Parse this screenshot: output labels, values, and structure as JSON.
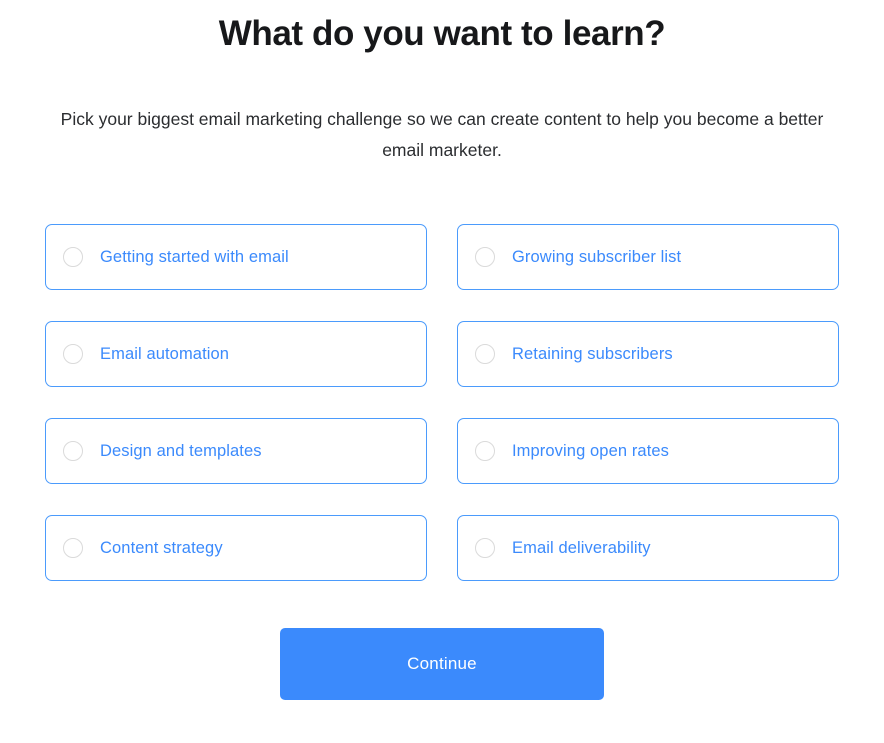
{
  "header": {
    "title": "What do you want to learn?",
    "subtitle": "Pick your biggest email marketing challenge so we can create content to help you become a better email marketer."
  },
  "options": [
    {
      "label": "Getting started with email",
      "icon": "radio-unselected-icon",
      "selected": false
    },
    {
      "label": "Growing subscriber list",
      "icon": "radio-unselected-icon",
      "selected": false
    },
    {
      "label": "Email automation",
      "icon": "radio-unselected-icon",
      "selected": false
    },
    {
      "label": "Retaining subscribers",
      "icon": "radio-unselected-icon",
      "selected": false
    },
    {
      "label": "Design and templates",
      "icon": "radio-unselected-icon",
      "selected": false
    },
    {
      "label": "Improving open rates",
      "icon": "radio-unselected-icon",
      "selected": false
    },
    {
      "label": "Content strategy",
      "icon": "radio-unselected-icon",
      "selected": false
    },
    {
      "label": "Email deliverability",
      "icon": "radio-unselected-icon",
      "selected": false
    }
  ],
  "footer": {
    "continue_label": "Continue"
  },
  "colors": {
    "accent_blue": "#3b8afc",
    "card_border_blue": "#4b9bfc",
    "radio_outline_gray": "#dadada",
    "title_black": "#17181a",
    "subtitle_gray": "#2b2d30",
    "background_white": "#ffffff",
    "button_text_white": "#ffffff"
  }
}
